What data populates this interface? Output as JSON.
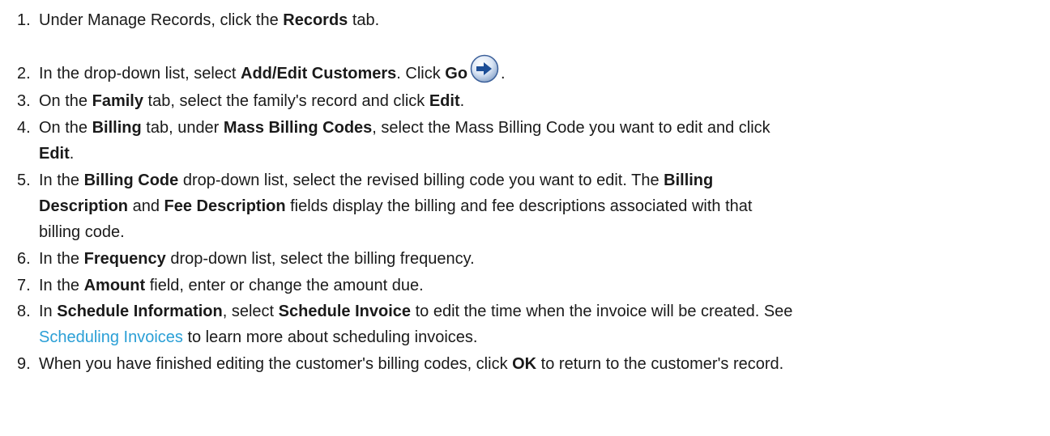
{
  "steps": [
    {
      "num": "1.",
      "parts": [
        "Under Manage Records, click the ",
        "Records",
        " tab."
      ]
    },
    {
      "num": "2.",
      "parts": [
        "In the drop-down list, select ",
        "Add/Edit Customers",
        ". Click ",
        "Go",
        "."
      ],
      "icon": "go-arrow-icon"
    },
    {
      "num": "3.",
      "parts": [
        "On the ",
        "Family",
        " tab, select the family's record and click ",
        "Edit",
        "."
      ]
    },
    {
      "num": "4.",
      "parts": [
        "On the ",
        "Billing",
        " tab, under ",
        "Mass Billing Codes",
        ", select the Mass Billing Code you want to edit and click",
        "Edit",
        "."
      ]
    },
    {
      "num": "5.",
      "parts": [
        "In the ",
        "Billing Code",
        " drop-down list, select the revised billing code you want to edit. The ",
        "Billing",
        "Description",
        " and ",
        "Fee Description",
        " fields display the billing and fee descriptions associated with that",
        "billing code."
      ]
    },
    {
      "num": "6.",
      "parts": [
        "In the ",
        "Frequency",
        " drop-down list, select the billing frequency."
      ]
    },
    {
      "num": "7.",
      "parts": [
        "In the ",
        "Amount",
        " field, enter or change the amount due."
      ]
    },
    {
      "num": "8.",
      "parts": [
        "In ",
        "Schedule Information",
        ", select ",
        "Schedule Invoice",
        " to edit the time when the invoice will be created. See",
        "Scheduling Invoices",
        " to learn more about scheduling invoices."
      ]
    },
    {
      "num": "9.",
      "parts": [
        "When you have finished editing the customer's billing codes, click ",
        "OK",
        " to return to the customer's record."
      ]
    }
  ]
}
